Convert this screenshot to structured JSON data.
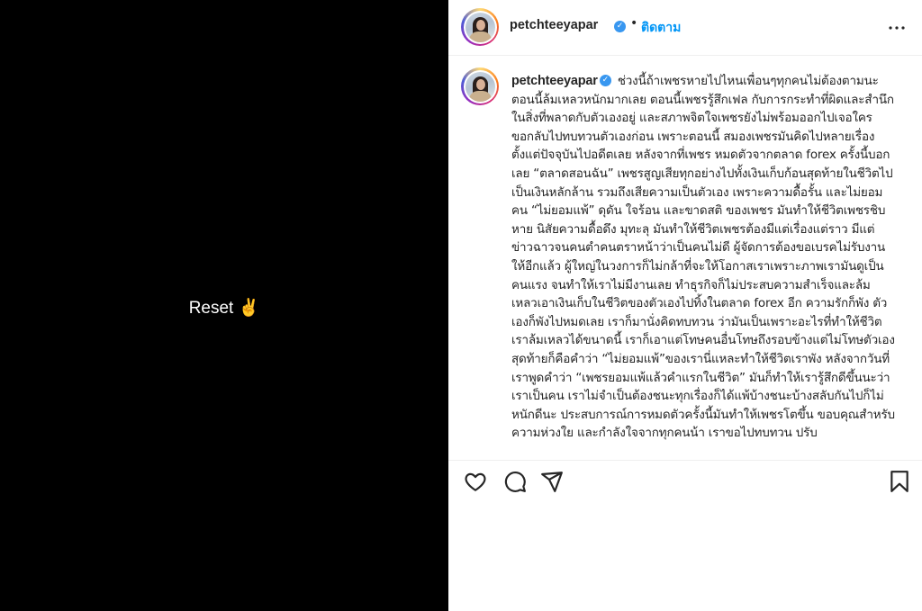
{
  "media": {
    "overlay_text": "Reset ✌️"
  },
  "post": {
    "username": "petchteeyapar",
    "separator": "•",
    "follow_label": "ติดตาม",
    "caption": "ช่วงนี้ถ้าเพชรหายไปไหนเพื่อนๆทุกคนไม่ต้องตามนะ ตอนนี้ล้มเหลวหนักมากเลย ตอนนี้เพชรรู้สึกเฟล กับการกระทำที่ผิดและสำนึกในสิ่งที่พลาดกับตัวเองอยู่ และสภาพจิตใจเพชรยังไม่พร้อมออกไปเจอใคร ขอกลับไปทบทวนตัวเองก่อน เพราะตอนนี้ สมองเพชรมันคิดไปหลายเรื่อง ตั้งแต่ปัจจุบันไปอดีตเลย หลังจากที่เพชร หมดตัวจากตลาด forex ครั้งนี้บอกเลย “ตลาดสอนฉัน” เพชรสูญเสียทุกอย่างไปทั้งเงินเก็บก้อนสุดท้ายในชีวิตไปเป็นเงินหลักล้าน รวมถึงเสียความเป็นตัวเอง เพราะความดื้อรั้น และไม่ยอมคน “ไม่ยอมแพ้” ดุดัน ใจร้อน และขาดสติ ของเพชร มันทำให้ชีวิตเพชรชิบหาย นิสัยความดื้อดึง มุทะลุ มันทำให้ชีวิตเพชรต้องมีแต่เรื่องแต่ราว มีแต่ข่าวฉาวจนคนตำคนตราหน้าว่าเป็นคนไม่ดี ผู้จัดการต้องขอเบรคไม่รับงานให้อีกแล้ว ผู้ใหญ่ในวงการก็ไม่กล้าที่จะให้โอกาสเราเพราะภาพเรามันดูเป็นคนแรง จนทำให้เราไม่มีงานเลย ทำธุรกิจก็ไม่ประสบความสำเร็จและล้มเหลวเอาเงินเก็บในชีวิตของตัวเองไปทิ้งในตลาด forex อีก ความรักก็พัง ตัวเองก็พังไปหมดเลย เราก็มานั่งคิดทบทวน ว่ามันเป็นเพราะอะไรที่ทำให้ชีวิตเราล้มเหลวได้ขนาดนี้ เราก็เอาแต่โทษคนอื่นโทษถึงรอบข้างแต่ไม่โทษตัวเอง สุดท้ายก็คือคำว่า “ไม่ยอมแพ้”ของเรานี่แหละทำให้ชีวิตเราพัง หลังจากวันที่เราพูดคำว่า “เพชรยอมแพ้แล้วคำแรกในชีวิต” มันก็ทำให้เรารู้สึกดีขึ้นนะว่าเราเป็นคน เราไม่จำเป็นต้องชนะทุกเรื่องก็ได้แพ้บ้างชนะบ้างสลับกันไปก็ไม่หนักดีนะ ประสบการณ์การหมดตัวครั้งนี้มันทำให้เพชรโตขึ้น ขอบคุณสำหรับความห่วงใย และกำลังใจจากทุกคนน้า เราขอไปทบทวน ปรับ"
  },
  "icons": {
    "more": "more-horizontal-icon",
    "like": "heart-icon",
    "comment": "comment-icon",
    "share": "send-icon",
    "save": "bookmark-icon",
    "verified": "verified-badge-icon"
  },
  "colors": {
    "accent": "#0095f6",
    "verified": "#3897f0",
    "text": "#262626"
  }
}
